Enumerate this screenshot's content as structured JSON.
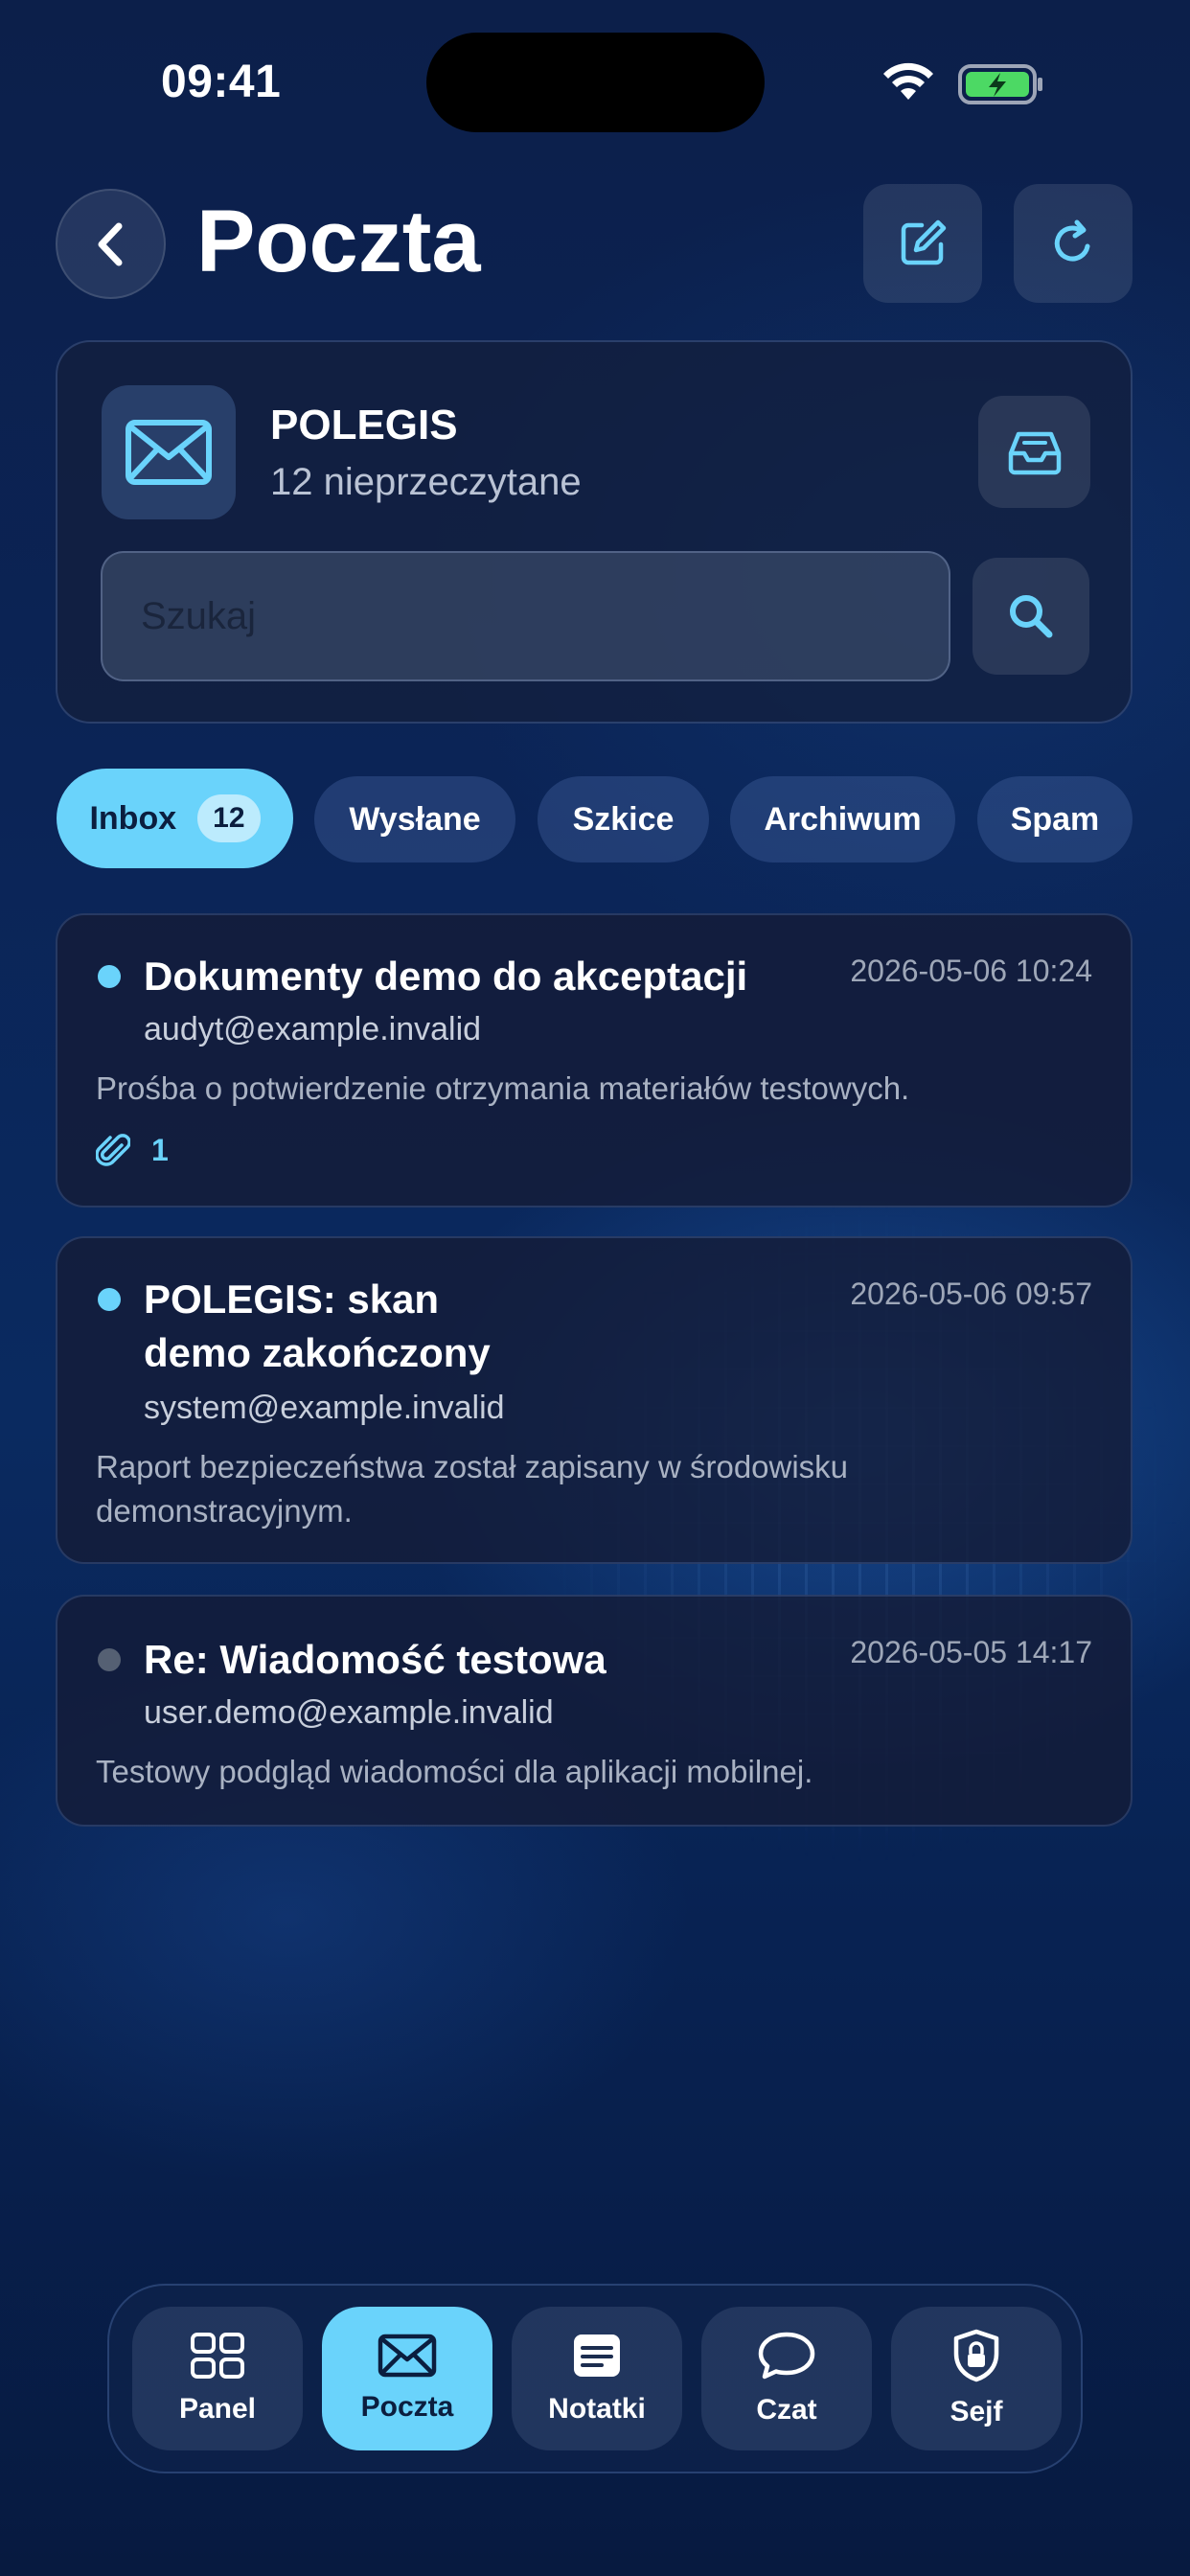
{
  "status_bar": {
    "time": "09:41"
  },
  "header": {
    "title": "Poczta"
  },
  "account": {
    "name": "POLEGIS",
    "unread": "12 nieprzeczytane",
    "search_placeholder": "Szukaj"
  },
  "tabs": [
    {
      "label": "Inbox",
      "badge": "12",
      "active": true
    },
    {
      "label": "Wysłane"
    },
    {
      "label": "Szkice"
    },
    {
      "label": "Archiwum"
    },
    {
      "label": "Spam"
    }
  ],
  "messages": [
    {
      "subject": "Dokumenty demo do akceptacji",
      "date": "2026-05-06 10:24",
      "from": "audyt@example.invalid",
      "preview": "Prośba o potwierdzenie otrzymania materiałów testowych.",
      "attachments": "1",
      "unread": true
    },
    {
      "subject_line1": "POLEGIS: skan",
      "subject_line2": "demo zakończony",
      "date": "2026-05-06 09:57",
      "from": "system@example.invalid",
      "preview_line1": "Raport bezpieczeństwa został zapisany w środowisku",
      "preview_line2": "demonstracyjnym.",
      "unread": true
    },
    {
      "subject": "Re: Wiadomość testowa",
      "date": "2026-05-05 14:17",
      "from": "user.demo@example.invalid",
      "preview": "Testowy podgląd wiadomości dla aplikacji mobilnej.",
      "unread": false
    }
  ],
  "nav": [
    {
      "label": "Panel",
      "icon": "grid-icon"
    },
    {
      "label": "Poczta",
      "icon": "mail-icon",
      "active": true
    },
    {
      "label": "Notatki",
      "icon": "notes-icon"
    },
    {
      "label": "Czat",
      "icon": "chat-icon"
    },
    {
      "label": "Sejf",
      "icon": "shield-lock-icon"
    }
  ],
  "colors": {
    "accent": "#6ad3fb",
    "background": "#0b2456",
    "unread_dot": "#6ad3fb",
    "read_dot": "#556073"
  }
}
